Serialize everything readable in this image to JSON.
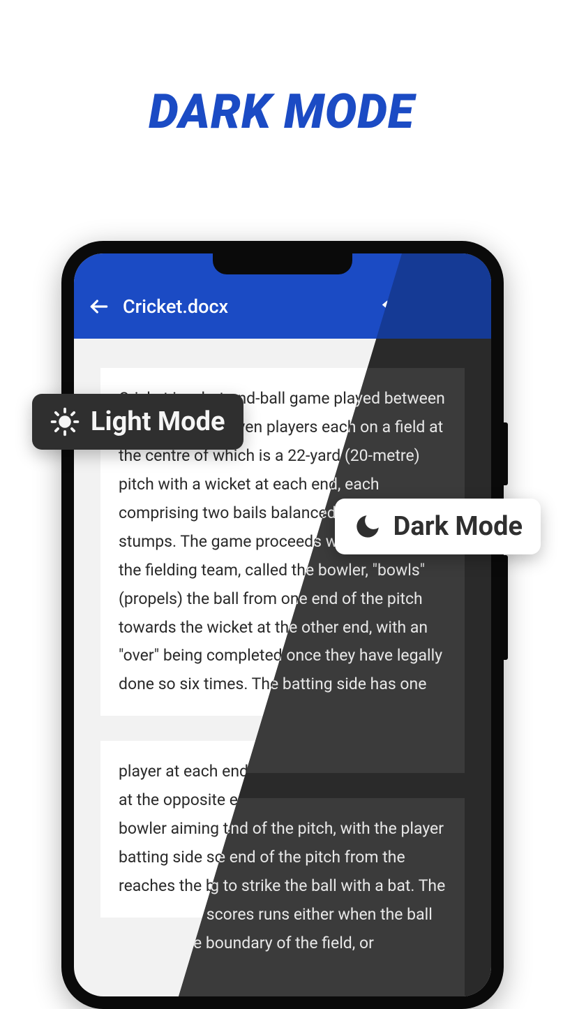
{
  "promo": {
    "title": "DARK MODE"
  },
  "header": {
    "file_title": "Cricket.docx"
  },
  "document": {
    "para1": "Cricket is a bat-and-ball game played between two teams of eleven players each on a field at the centre of which is a 22-yard (20-metre) pitch with a wicket at each end, each comprising two bails balanced on three stumps. The game proceeds when a player on the fielding team, called the bowler, \"bowls\" (propels) the ball from one end of the pitch towards the wicket at the other end, with an \"over\" being completed once they have legally done so six times. The batting side has one",
    "para2": "player at each end of the pitch, with the player at the opposite end of the pitch from the bowler aiming to strike the ball with a bat. The batting side scores runs either when the ball reaches the boundary of the field, or"
  },
  "badges": {
    "light": "Light Mode",
    "dark": "Dark Mode"
  }
}
